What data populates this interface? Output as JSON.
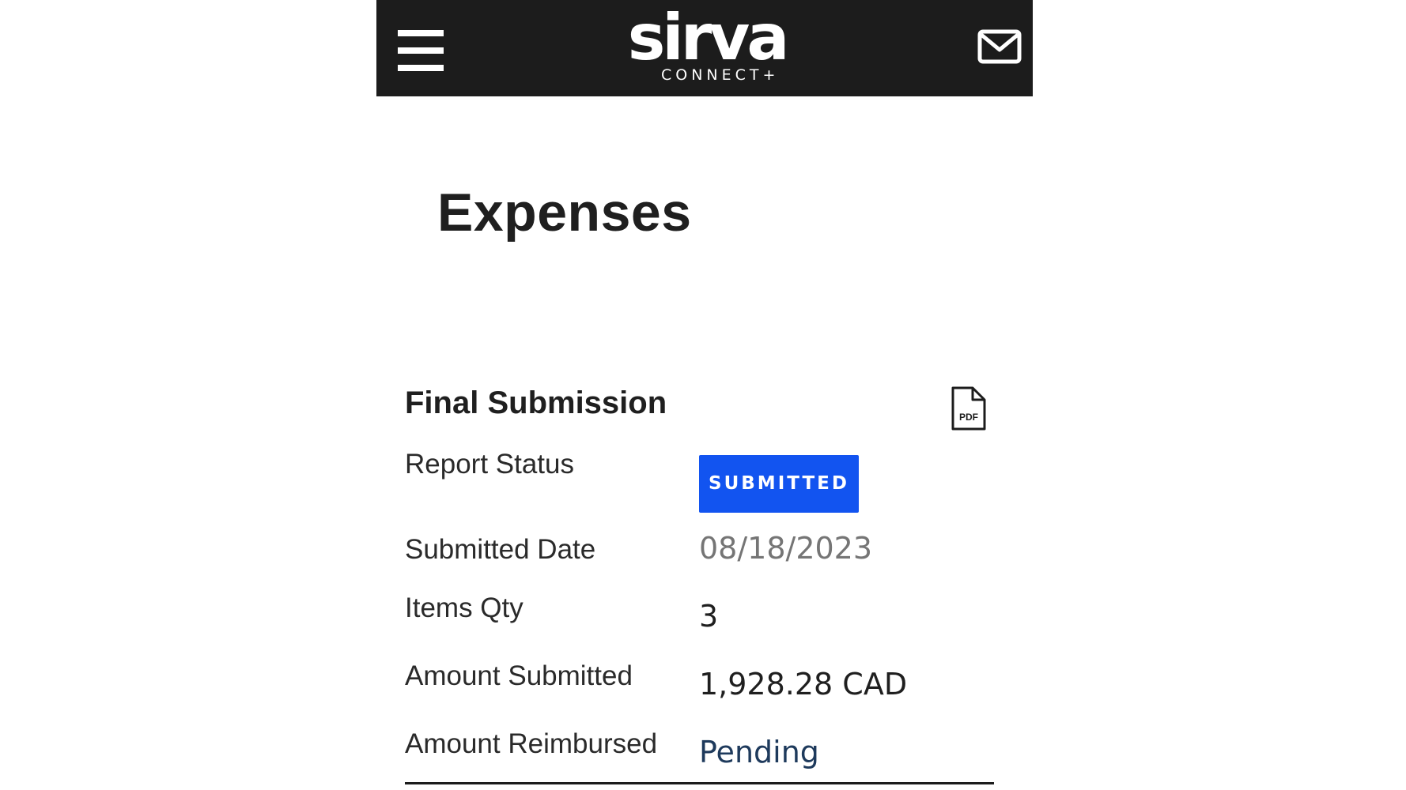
{
  "header": {
    "logo_word": "sirva",
    "logo_sub": "CONNECT+",
    "menu_icon": "hamburger-menu-icon",
    "mail_icon": "envelope-icon"
  },
  "page": {
    "title": "Expenses"
  },
  "card": {
    "title": "Final Submission",
    "pdf_icon": "pdf-file-icon",
    "pdf_label": "PDF",
    "rows": [
      {
        "label": "Report Status",
        "value": "SUBMITTED"
      },
      {
        "label": "Submitted Date",
        "value": "08/18/2023"
      },
      {
        "label": "Items Qty",
        "value": "3"
      },
      {
        "label": "Amount Submitted",
        "value": "1,928.28 CAD"
      },
      {
        "label": "Amount Reimbursed",
        "value": "Pending"
      }
    ]
  },
  "colors": {
    "header_bg": "#1c1c1c",
    "status_badge_bg": "#1254f0",
    "date_text": "#757575",
    "pending_text": "#1e3a5c"
  }
}
